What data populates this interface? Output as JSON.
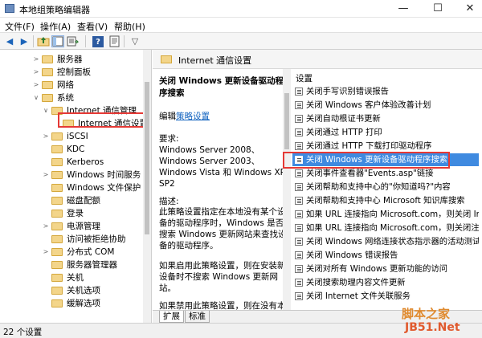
{
  "window": {
    "title": "本地组策略编辑器",
    "min": "—",
    "max": "☐",
    "close": "✕"
  },
  "menu": [
    "文件(F)",
    "操作(A)",
    "查看(V)",
    "帮助(H)"
  ],
  "toolbar": {
    "back": "◀",
    "forward": "▶",
    "help": "?",
    "filter": "▽"
  },
  "tree": {
    "items": [
      {
        "label": "服务器",
        "expander": ">"
      },
      {
        "label": "控制面板",
        "expander": ">"
      },
      {
        "label": "网络",
        "expander": ">"
      },
      {
        "label": "系统",
        "expander": "∨"
      },
      {
        "label": "Internet 通信管理",
        "expander": "∨"
      },
      {
        "label": "Internet 通信设置",
        "expander": ""
      },
      {
        "label": "iSCSI",
        "expander": ">"
      },
      {
        "label": "KDC",
        "expander": ""
      },
      {
        "label": "Kerberos",
        "expander": ""
      },
      {
        "label": "Windows 时间服务",
        "expander": ">"
      },
      {
        "label": "Windows 文件保护",
        "expander": ""
      },
      {
        "label": "磁盘配额",
        "expander": ""
      },
      {
        "label": "登录",
        "expander": ""
      },
      {
        "label": "电源管理",
        "expander": ">"
      },
      {
        "label": "访问被拒绝协助",
        "expander": ""
      },
      {
        "label": "分布式 COM",
        "expander": ">"
      },
      {
        "label": "服务器管理器",
        "expander": ""
      },
      {
        "label": "关机",
        "expander": ""
      },
      {
        "label": "关机选项",
        "expander": ""
      },
      {
        "label": "缓解选项",
        "expander": ""
      }
    ]
  },
  "right_header": {
    "title": "Internet 通信设置"
  },
  "description": {
    "heading": "关闭 Windows 更新设备驱动程序搜索",
    "edit_prefix": "编辑",
    "edit_link": "策略设置",
    "requirements_label": "要求:",
    "requirements_value": "Windows Server 2008、Windows Server 2003、Windows Vista 和 Windows XP SP2",
    "desc_label": "描述:",
    "desc_text": "此策略设置指定在本地没有某个设备的驱动程序时，Windows 是否搜索 Windows 更新网站来查找设备的驱动程序。",
    "desc_text2": "如果启用此策略设置，则在安装新设备时不搜索 Windows 更新网站。",
    "desc_text3": "如果禁用此策略设置，则在没有本地驱动程序时..."
  },
  "list": {
    "column_header": "设置",
    "rows": [
      "关闭手写识别错误报告",
      "关闭 Windows 客户体验改善计划",
      "关闭自动根证书更新",
      "关闭通过 HTTP 打印",
      "关闭通过 HTTP 下载打印驱动程序",
      "关闭 Windows 更新设备驱动程序搜索",
      "关闭事件查看器\"Events.asp\"链接",
      "关闭帮助和支持中心的\"你知道吗?\"内容",
      "关闭帮助和支持中心 Microsoft 知识库搜索",
      "如果 URL 连接指向 Microsoft.com，则关闭 Int",
      "如果 URL 连接指向 Microsoft.com，则关闭注册",
      "关闭 Windows 网络连接状态指示器的活动测试",
      "关闭 Windows 错误报告",
      "关闭对所有 Windows 更新功能的访问",
      "关闭搜索助理内容文件更新",
      "关闭 Internet 文件关联服务"
    ],
    "selected_index": 5
  },
  "tabs": [
    "扩展",
    "标准"
  ],
  "status": {
    "text": "22 个设置"
  },
  "watermark": {
    "line1": "脚本之家",
    "line2": "JB51.Net"
  }
}
